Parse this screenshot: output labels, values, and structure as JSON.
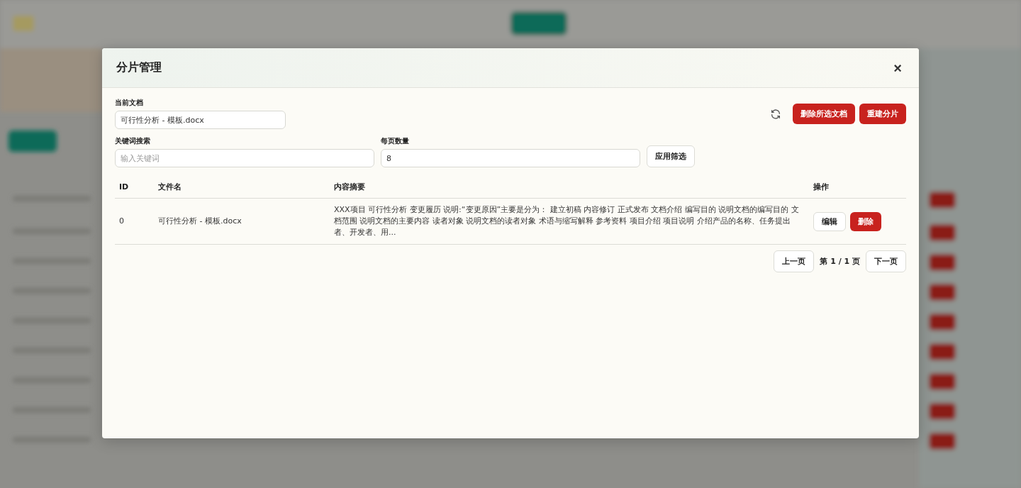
{
  "dialog": {
    "title": "分片管理",
    "close": "×"
  },
  "current_doc": {
    "label": "当前文档",
    "value": "可行性分析 - 模板.docx"
  },
  "actions": [
    {
      "label": "删除所选文档"
    },
    {
      "label": "重建分片"
    }
  ],
  "filters": {
    "keyword": {
      "label": "关键词搜索",
      "placeholder": "输入关键词"
    },
    "page_size": {
      "label": "每页数量",
      "value": "8"
    },
    "apply": "应用筛选"
  },
  "table": {
    "columns": [
      "ID",
      "文件名",
      "内容摘要",
      "操作"
    ],
    "rows": [
      {
        "id": "0",
        "file": "可行性分析 - 模板.docx",
        "summary": "XXX项目 可行性分析 变更履历 说明:“变更原因”主要是分为： 建立初稿 内容修订 正式发布 文档介绍 编写目的 说明文档的编写目的 文档范围 说明文档的主要内容 读者对象 说明文档的读者对象 术语与缩写解释 参考资料 项目介绍 项目说明 介绍产品的名称、任务提出者、开发者、用...",
        "edit": "编辑",
        "delete": "删除"
      }
    ]
  },
  "pagination": {
    "prev": "上一页",
    "info": "第 1 / 1 页",
    "next": "下一页"
  }
}
